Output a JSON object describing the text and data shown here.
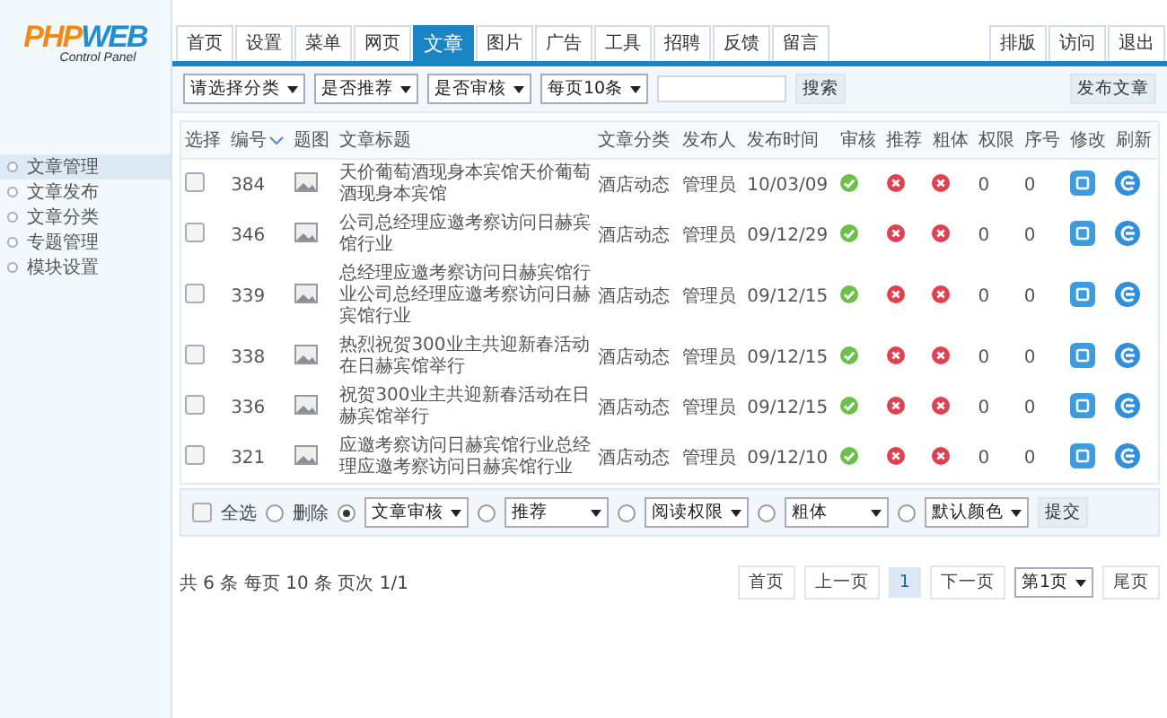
{
  "logo": {
    "part_1": "PHP",
    "part_2": "WEB",
    "subtitle": "Control Panel"
  },
  "nav_tabs": [
    {
      "label": "首页",
      "selected": false
    },
    {
      "label": "设置",
      "selected": false
    },
    {
      "label": "菜单",
      "selected": false
    },
    {
      "label": "网页",
      "selected": false
    },
    {
      "label": "文章",
      "selected": true
    },
    {
      "label": "图片",
      "selected": false
    },
    {
      "label": "广告",
      "selected": false
    },
    {
      "label": "工具",
      "selected": false
    },
    {
      "label": "招聘",
      "selected": false
    },
    {
      "label": "反馈",
      "selected": false
    },
    {
      "label": "留言",
      "selected": false
    }
  ],
  "right_tabs": [
    {
      "label": "排版"
    },
    {
      "label": "访问"
    },
    {
      "label": "退出"
    }
  ],
  "filters": {
    "selects": [
      "请选择分类",
      "是否推荐",
      "是否审核",
      "每页10条"
    ],
    "search_button": "搜索",
    "publish_button": "发布文章"
  },
  "sidebar": {
    "items": [
      {
        "label": "文章管理",
        "selected": true
      },
      {
        "label": "文章发布",
        "selected": false
      },
      {
        "label": "文章分类",
        "selected": false
      },
      {
        "label": "专题管理",
        "selected": false
      },
      {
        "label": "模块设置",
        "selected": false
      }
    ]
  },
  "table": {
    "columns": [
      {
        "label": "选择",
        "sorted": false
      },
      {
        "label": "编号",
        "sorted": true
      },
      {
        "label": "题图",
        "sorted": false
      },
      {
        "label": "文章标题",
        "sorted": false
      },
      {
        "label": "文章分类",
        "sorted": false
      },
      {
        "label": "发布人",
        "sorted": false
      },
      {
        "label": "发布时间",
        "sorted": false
      },
      {
        "label": "审核",
        "sorted": false
      },
      {
        "label": "推荐",
        "sorted": false
      },
      {
        "label": "粗体",
        "sorted": false
      },
      {
        "label": "权限",
        "sorted": false
      },
      {
        "label": "序号",
        "sorted": false
      },
      {
        "label": "修改",
        "sorted": false
      },
      {
        "label": "刷新",
        "sorted": false
      }
    ],
    "rows": [
      {
        "checked": false,
        "id": "384",
        "title": "天价葡萄酒现身本宾馆天价葡萄酒现身本宾馆",
        "category": "酒店动态",
        "author": "管理员",
        "date": "10/03/09",
        "approved": true,
        "recommended": false,
        "bold": false,
        "permission": "0",
        "order": "0"
      },
      {
        "checked": false,
        "id": "346",
        "title": "公司总经理应邀考察访问日赫宾馆行业",
        "category": "酒店动态",
        "author": "管理员",
        "date": "09/12/29",
        "approved": true,
        "recommended": false,
        "bold": false,
        "permission": "0",
        "order": "0"
      },
      {
        "checked": false,
        "id": "339",
        "title": "总经理应邀考察访问日赫宾馆行业公司总经理应邀考察访问日赫宾馆行业",
        "category": "酒店动态",
        "author": "管理员",
        "date": "09/12/15",
        "approved": true,
        "recommended": false,
        "bold": false,
        "permission": "0",
        "order": "0"
      },
      {
        "checked": false,
        "id": "338",
        "title": "热烈祝贺300业主共迎新春活动在日赫宾馆举行",
        "category": "酒店动态",
        "author": "管理员",
        "date": "09/12/15",
        "approved": true,
        "recommended": false,
        "bold": false,
        "permission": "0",
        "order": "0"
      },
      {
        "checked": false,
        "id": "336",
        "title": "祝贺300业主共迎新春活动在日赫宾馆举行",
        "category": "酒店动态",
        "author": "管理员",
        "date": "09/12/15",
        "approved": true,
        "recommended": false,
        "bold": false,
        "permission": "0",
        "order": "0"
      },
      {
        "checked": false,
        "id": "321",
        "title": "应邀考察访问日赫宾馆行业总经理应邀考察访问日赫宾馆行业",
        "category": "酒店动态",
        "author": "管理员",
        "date": "09/12/10",
        "approved": true,
        "recommended": false,
        "bold": false,
        "permission": "0",
        "order": "0"
      }
    ]
  },
  "bulk_bar": {
    "select_all": {
      "label": "全选",
      "checked": false
    },
    "options": [
      {
        "kind": "label",
        "label": "删除",
        "selected": false
      },
      {
        "kind": "select",
        "label": "文章审核",
        "selected": true
      },
      {
        "kind": "select",
        "label": "推荐",
        "selected": false
      },
      {
        "kind": "select",
        "label": "阅读权限",
        "selected": false
      },
      {
        "kind": "select",
        "label": "粗体",
        "selected": false
      },
      {
        "kind": "select",
        "label": "默认颜色",
        "selected": false
      }
    ],
    "submit_button": "提交"
  },
  "pagination": {
    "summary": "共 6 条 每页 10 条 页次 1/1",
    "controls": [
      {
        "kind": "button",
        "label": "首页",
        "selected": false
      },
      {
        "kind": "button",
        "label": "上一页",
        "selected": false
      },
      {
        "kind": "button",
        "label": "1",
        "selected": true
      },
      {
        "kind": "button",
        "label": "下一页",
        "selected": false
      },
      {
        "kind": "select",
        "label": "第1页"
      },
      {
        "kind": "button",
        "label": "尾页",
        "selected": false
      }
    ]
  }
}
